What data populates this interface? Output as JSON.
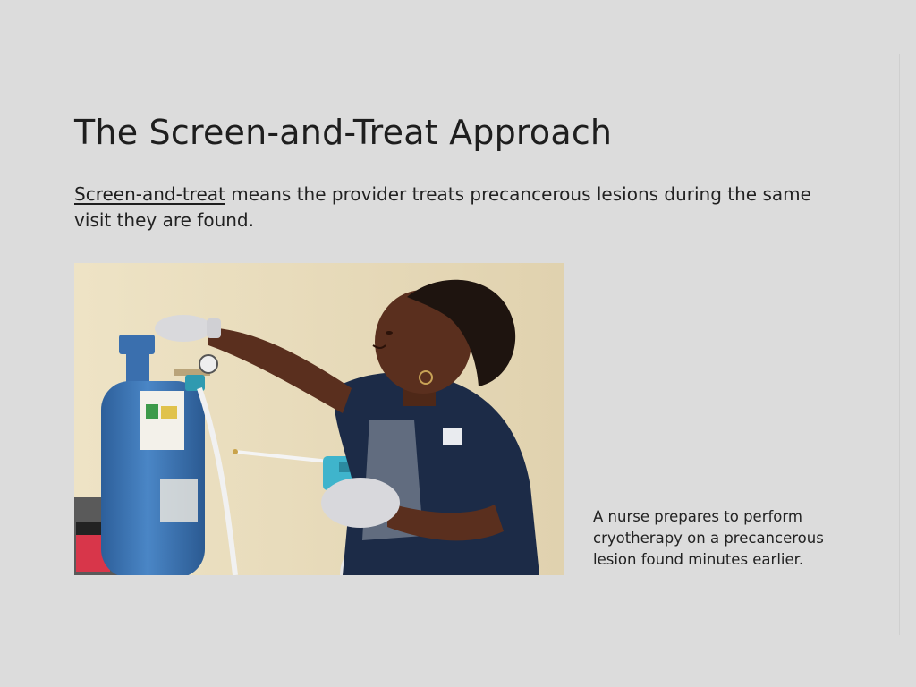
{
  "slide": {
    "title": "The Screen-and-Treat Approach",
    "intro_term": "Screen-and-treat",
    "intro_rest": " means the provider treats precancerous lesions during the same visit they are found.",
    "photo_alt": "A nurse prepares to perform cryotherapy",
    "caption": "A nurse prepares to perform cryotherapy on a precancerous lesion found minutes earlier."
  },
  "colors": {
    "background": "#dcdcdc",
    "text": "#222222",
    "tank": "#3b74b5",
    "uniform": "#1b2a45",
    "wall": "#e9dcbc"
  }
}
